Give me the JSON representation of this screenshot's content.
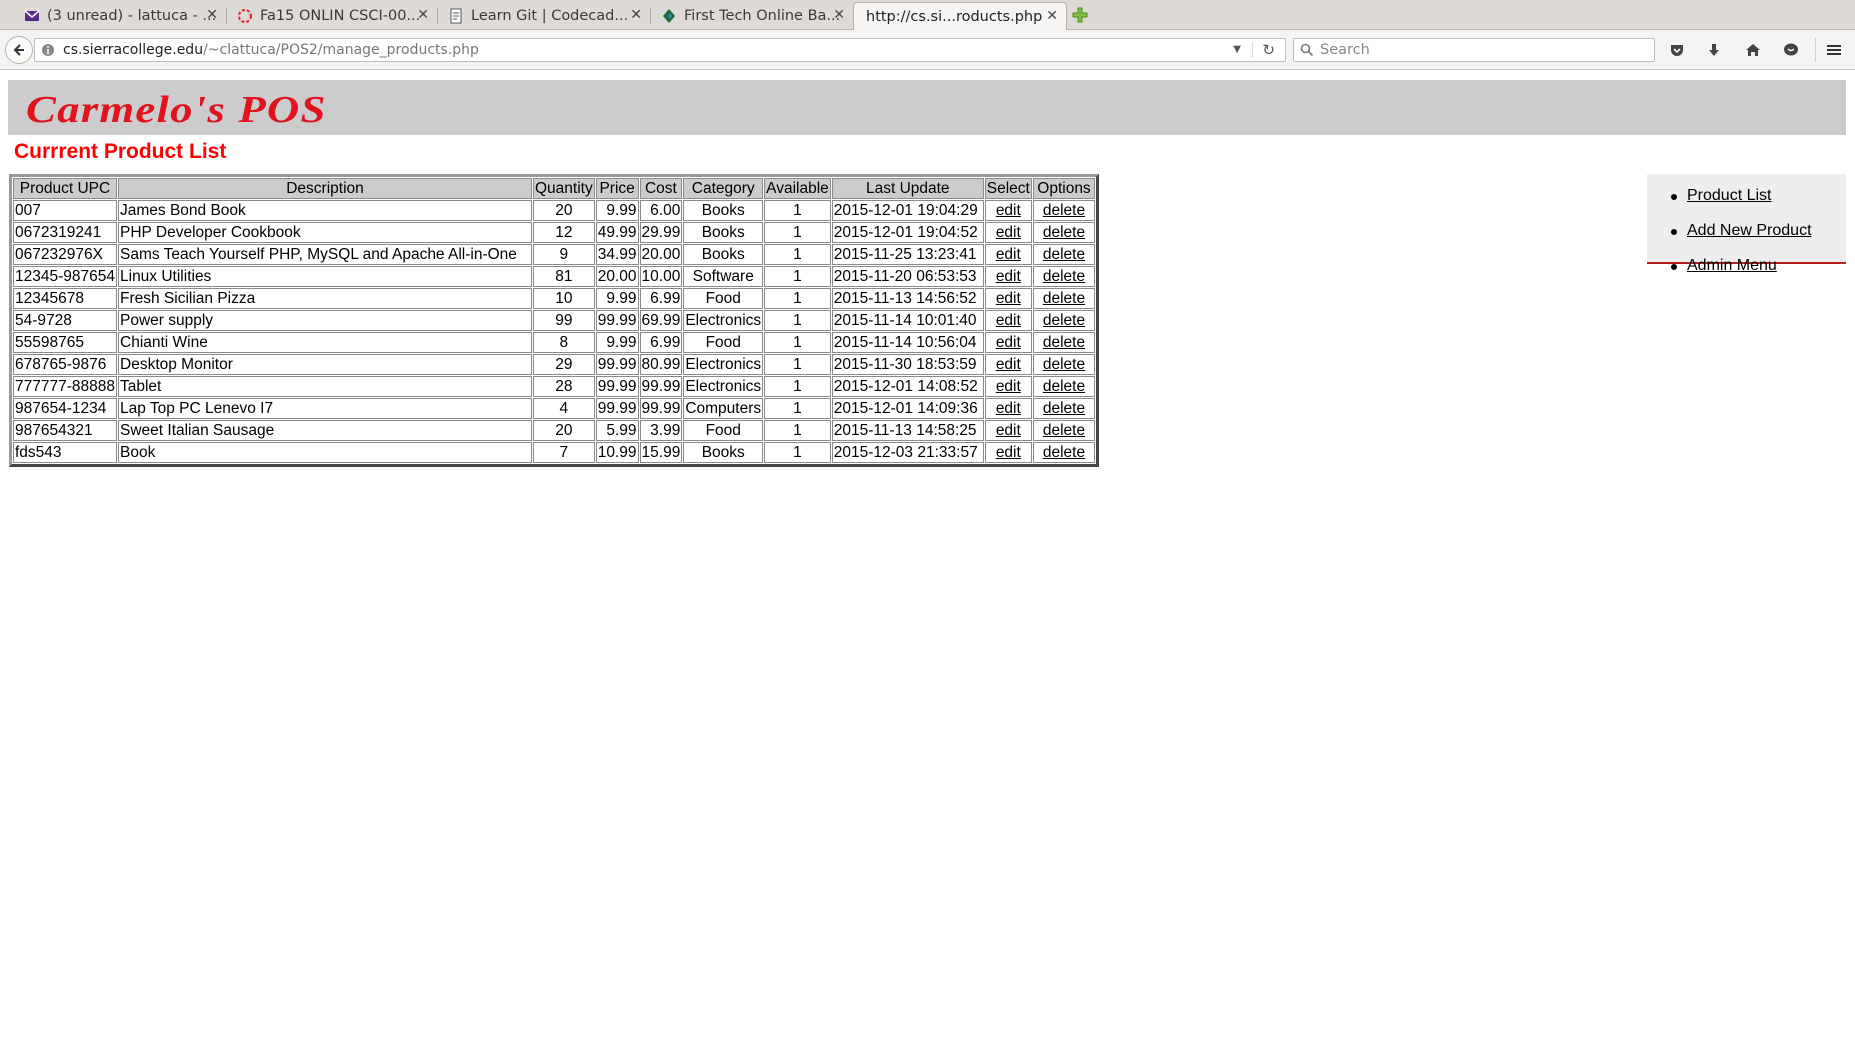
{
  "browser": {
    "tabs": [
      {
        "label": "(3 unread) - lattuca - ...",
        "icon": "mail-icon"
      },
      {
        "label": "Fa15 ONLIN CSCI-00...",
        "icon": "ring-icon"
      },
      {
        "label": "Learn Git | Codecad...",
        "icon": "page-icon"
      },
      {
        "label": "First Tech Online Ba...",
        "icon": "bank-icon"
      },
      {
        "label": "http://cs.si...roducts.php",
        "icon": "none",
        "active": true
      }
    ],
    "url_host": "cs.sierracollege.edu",
    "url_path": "/~clattuca/POS2/manage_products.php",
    "search_placeholder": "Search"
  },
  "page": {
    "logo": "Carmelo's POS",
    "title": "Currrent Product List"
  },
  "table": {
    "headers": [
      "Product UPC",
      "Description",
      "Quantity",
      "Price",
      "Cost",
      "Category",
      "Available",
      "Last Update",
      "Select",
      "Options"
    ],
    "edit_label": "edit",
    "delete_label": "delete",
    "rows": [
      {
        "upc": "007",
        "description": "James Bond Book",
        "quantity": "20",
        "price": "9.99",
        "cost": "6.00",
        "category": "Books",
        "available": "1",
        "updated": "2015-12-01 19:04:29"
      },
      {
        "upc": "0672319241",
        "description": "PHP Developer Cookbook",
        "quantity": "12",
        "price": "49.99",
        "cost": "29.99",
        "category": "Books",
        "available": "1",
        "updated": "2015-12-01 19:04:52"
      },
      {
        "upc": "067232976X",
        "description": "Sams Teach Yourself PHP, MySQL and Apache All-in-One",
        "quantity": "9",
        "price": "34.99",
        "cost": "20.00",
        "category": "Books",
        "available": "1",
        "updated": "2015-11-25 13:23:41"
      },
      {
        "upc": "12345-987654",
        "description": "Linux Utilities",
        "quantity": "81",
        "price": "20.00",
        "cost": "10.00",
        "category": "Software",
        "available": "1",
        "updated": "2015-11-20 06:53:53"
      },
      {
        "upc": "12345678",
        "description": "Fresh Sicilian Pizza",
        "quantity": "10",
        "price": "9.99",
        "cost": "6.99",
        "category": "Food",
        "available": "1",
        "updated": "2015-11-13 14:56:52"
      },
      {
        "upc": "54-9728",
        "description": "Power supply",
        "quantity": "99",
        "price": "99.99",
        "cost": "69.99",
        "category": "Electronics",
        "available": "1",
        "updated": "2015-11-14 10:01:40"
      },
      {
        "upc": "55598765",
        "description": "Chianti Wine",
        "quantity": "8",
        "price": "9.99",
        "cost": "6.99",
        "category": "Food",
        "available": "1",
        "updated": "2015-11-14 10:56:04"
      },
      {
        "upc": "678765-9876",
        "description": "Desktop Monitor",
        "quantity": "29",
        "price": "99.99",
        "cost": "80.99",
        "category": "Electronics",
        "available": "1",
        "updated": "2015-11-30 18:53:59"
      },
      {
        "upc": "777777-88888",
        "description": "Tablet",
        "quantity": "28",
        "price": "99.99",
        "cost": "99.99",
        "category": "Electronics",
        "available": "1",
        "updated": "2015-12-01 14:08:52"
      },
      {
        "upc": "987654-1234",
        "description": "Lap Top PC Lenevo I7",
        "quantity": "4",
        "price": "99.99",
        "cost": "99.99",
        "category": "Computers",
        "available": "1",
        "updated": "2015-12-01 14:09:36"
      },
      {
        "upc": "987654321",
        "description": "Sweet Italian Sausage",
        "quantity": "20",
        "price": "5.99",
        "cost": "3.99",
        "category": "Food",
        "available": "1",
        "updated": "2015-11-13 14:58:25"
      },
      {
        "upc": "fds543",
        "description": "Book",
        "quantity": "7",
        "price": "10.99",
        "cost": "15.99",
        "category": "Books",
        "available": "1",
        "updated": "2015-12-03 21:33:57"
      }
    ]
  },
  "sidebar": {
    "items": [
      {
        "label": "Product List"
      },
      {
        "label": "Add New Product"
      },
      {
        "label": "Admin Menu"
      }
    ]
  }
}
